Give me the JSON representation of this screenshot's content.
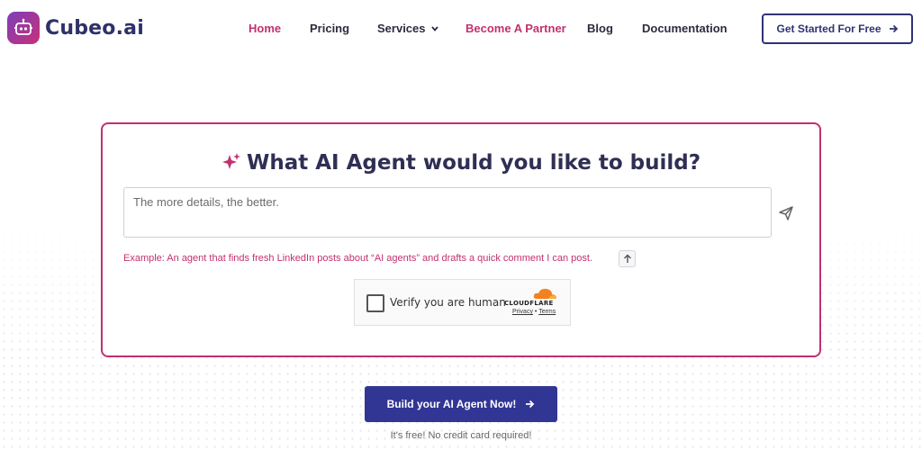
{
  "brand": {
    "name": "Cubeo.ai"
  },
  "nav": {
    "items": [
      {
        "label": "Home"
      },
      {
        "label": "Pricing"
      },
      {
        "label": "Services"
      },
      {
        "label": "Become A Partner"
      },
      {
        "label": "Blog"
      },
      {
        "label": "Documentation"
      }
    ],
    "cta_label": "Get Started For Free"
  },
  "builder": {
    "title": "What AI Agent would you like to build?",
    "prompt_placeholder": "The more details, the better.",
    "prompt_value": "",
    "example_text": "Example: An agent that finds fresh LinkedIn posts about “AI agents” and drafts a quick comment I can post."
  },
  "captcha": {
    "label": "Verify you are human",
    "provider": "CLOUDFLARE",
    "privacy": "Privacy",
    "separator": "•",
    "terms": "Terms"
  },
  "cta": {
    "build_label": "Build your AI Agent Now!",
    "note": "It's free! No credit card required!"
  },
  "colors": {
    "accent": "#c2306f",
    "primary": "#313593",
    "navy": "#2f3374"
  },
  "icons": [
    "robot-logo-icon",
    "chevron-down-icon",
    "arrow-right-icon",
    "sparkle-icon",
    "send-icon",
    "arrow-up-icon",
    "cloudflare-icon"
  ]
}
